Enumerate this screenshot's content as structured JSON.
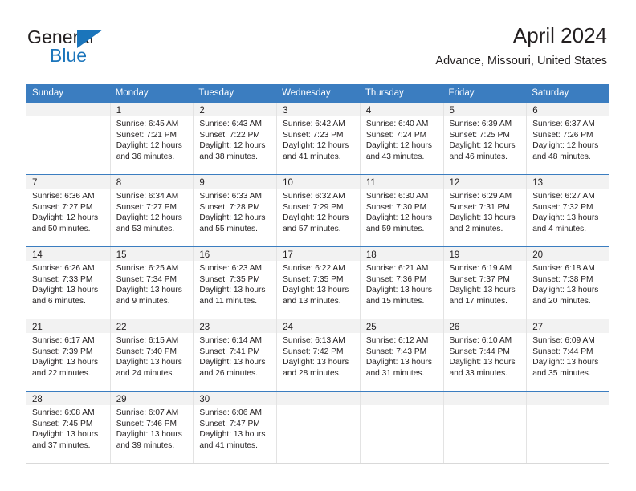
{
  "brand": {
    "name_part1": "General",
    "name_part2": "Blue",
    "triangle_color": "#1b75bb"
  },
  "header": {
    "title": "April 2024",
    "subtitle": "Advance, Missouri, United States"
  },
  "theme": {
    "header_blue": "#3b7dc0",
    "daynum_band": "#f2f2f2",
    "text": "#231f20"
  },
  "calendar": {
    "weekday_headers": [
      "Sunday",
      "Monday",
      "Tuesday",
      "Wednesday",
      "Thursday",
      "Friday",
      "Saturday"
    ],
    "weeks": [
      [
        {
          "day": "",
          "sunrise": "",
          "sunset": "",
          "daylight": "",
          "daylight2": ""
        },
        {
          "day": "1",
          "sunrise": "Sunrise: 6:45 AM",
          "sunset": "Sunset: 7:21 PM",
          "daylight": "Daylight: 12 hours",
          "daylight2": "and 36 minutes."
        },
        {
          "day": "2",
          "sunrise": "Sunrise: 6:43 AM",
          "sunset": "Sunset: 7:22 PM",
          "daylight": "Daylight: 12 hours",
          "daylight2": "and 38 minutes."
        },
        {
          "day": "3",
          "sunrise": "Sunrise: 6:42 AM",
          "sunset": "Sunset: 7:23 PM",
          "daylight": "Daylight: 12 hours",
          "daylight2": "and 41 minutes."
        },
        {
          "day": "4",
          "sunrise": "Sunrise: 6:40 AM",
          "sunset": "Sunset: 7:24 PM",
          "daylight": "Daylight: 12 hours",
          "daylight2": "and 43 minutes."
        },
        {
          "day": "5",
          "sunrise": "Sunrise: 6:39 AM",
          "sunset": "Sunset: 7:25 PM",
          "daylight": "Daylight: 12 hours",
          "daylight2": "and 46 minutes."
        },
        {
          "day": "6",
          "sunrise": "Sunrise: 6:37 AM",
          "sunset": "Sunset: 7:26 PM",
          "daylight": "Daylight: 12 hours",
          "daylight2": "and 48 minutes."
        }
      ],
      [
        {
          "day": "7",
          "sunrise": "Sunrise: 6:36 AM",
          "sunset": "Sunset: 7:27 PM",
          "daylight": "Daylight: 12 hours",
          "daylight2": "and 50 minutes."
        },
        {
          "day": "8",
          "sunrise": "Sunrise: 6:34 AM",
          "sunset": "Sunset: 7:27 PM",
          "daylight": "Daylight: 12 hours",
          "daylight2": "and 53 minutes."
        },
        {
          "day": "9",
          "sunrise": "Sunrise: 6:33 AM",
          "sunset": "Sunset: 7:28 PM",
          "daylight": "Daylight: 12 hours",
          "daylight2": "and 55 minutes."
        },
        {
          "day": "10",
          "sunrise": "Sunrise: 6:32 AM",
          "sunset": "Sunset: 7:29 PM",
          "daylight": "Daylight: 12 hours",
          "daylight2": "and 57 minutes."
        },
        {
          "day": "11",
          "sunrise": "Sunrise: 6:30 AM",
          "sunset": "Sunset: 7:30 PM",
          "daylight": "Daylight: 12 hours",
          "daylight2": "and 59 minutes."
        },
        {
          "day": "12",
          "sunrise": "Sunrise: 6:29 AM",
          "sunset": "Sunset: 7:31 PM",
          "daylight": "Daylight: 13 hours",
          "daylight2": "and 2 minutes."
        },
        {
          "day": "13",
          "sunrise": "Sunrise: 6:27 AM",
          "sunset": "Sunset: 7:32 PM",
          "daylight": "Daylight: 13 hours",
          "daylight2": "and 4 minutes."
        }
      ],
      [
        {
          "day": "14",
          "sunrise": "Sunrise: 6:26 AM",
          "sunset": "Sunset: 7:33 PM",
          "daylight": "Daylight: 13 hours",
          "daylight2": "and 6 minutes."
        },
        {
          "day": "15",
          "sunrise": "Sunrise: 6:25 AM",
          "sunset": "Sunset: 7:34 PM",
          "daylight": "Daylight: 13 hours",
          "daylight2": "and 9 minutes."
        },
        {
          "day": "16",
          "sunrise": "Sunrise: 6:23 AM",
          "sunset": "Sunset: 7:35 PM",
          "daylight": "Daylight: 13 hours",
          "daylight2": "and 11 minutes."
        },
        {
          "day": "17",
          "sunrise": "Sunrise: 6:22 AM",
          "sunset": "Sunset: 7:35 PM",
          "daylight": "Daylight: 13 hours",
          "daylight2": "and 13 minutes."
        },
        {
          "day": "18",
          "sunrise": "Sunrise: 6:21 AM",
          "sunset": "Sunset: 7:36 PM",
          "daylight": "Daylight: 13 hours",
          "daylight2": "and 15 minutes."
        },
        {
          "day": "19",
          "sunrise": "Sunrise: 6:19 AM",
          "sunset": "Sunset: 7:37 PM",
          "daylight": "Daylight: 13 hours",
          "daylight2": "and 17 minutes."
        },
        {
          "day": "20",
          "sunrise": "Sunrise: 6:18 AM",
          "sunset": "Sunset: 7:38 PM",
          "daylight": "Daylight: 13 hours",
          "daylight2": "and 20 minutes."
        }
      ],
      [
        {
          "day": "21",
          "sunrise": "Sunrise: 6:17 AM",
          "sunset": "Sunset: 7:39 PM",
          "daylight": "Daylight: 13 hours",
          "daylight2": "and 22 minutes."
        },
        {
          "day": "22",
          "sunrise": "Sunrise: 6:15 AM",
          "sunset": "Sunset: 7:40 PM",
          "daylight": "Daylight: 13 hours",
          "daylight2": "and 24 minutes."
        },
        {
          "day": "23",
          "sunrise": "Sunrise: 6:14 AM",
          "sunset": "Sunset: 7:41 PM",
          "daylight": "Daylight: 13 hours",
          "daylight2": "and 26 minutes."
        },
        {
          "day": "24",
          "sunrise": "Sunrise: 6:13 AM",
          "sunset": "Sunset: 7:42 PM",
          "daylight": "Daylight: 13 hours",
          "daylight2": "and 28 minutes."
        },
        {
          "day": "25",
          "sunrise": "Sunrise: 6:12 AM",
          "sunset": "Sunset: 7:43 PM",
          "daylight": "Daylight: 13 hours",
          "daylight2": "and 31 minutes."
        },
        {
          "day": "26",
          "sunrise": "Sunrise: 6:10 AM",
          "sunset": "Sunset: 7:44 PM",
          "daylight": "Daylight: 13 hours",
          "daylight2": "and 33 minutes."
        },
        {
          "day": "27",
          "sunrise": "Sunrise: 6:09 AM",
          "sunset": "Sunset: 7:44 PM",
          "daylight": "Daylight: 13 hours",
          "daylight2": "and 35 minutes."
        }
      ],
      [
        {
          "day": "28",
          "sunrise": "Sunrise: 6:08 AM",
          "sunset": "Sunset: 7:45 PM",
          "daylight": "Daylight: 13 hours",
          "daylight2": "and 37 minutes."
        },
        {
          "day": "29",
          "sunrise": "Sunrise: 6:07 AM",
          "sunset": "Sunset: 7:46 PM",
          "daylight": "Daylight: 13 hours",
          "daylight2": "and 39 minutes."
        },
        {
          "day": "30",
          "sunrise": "Sunrise: 6:06 AM",
          "sunset": "Sunset: 7:47 PM",
          "daylight": "Daylight: 13 hours",
          "daylight2": "and 41 minutes."
        },
        {
          "day": "",
          "sunrise": "",
          "sunset": "",
          "daylight": "",
          "daylight2": ""
        },
        {
          "day": "",
          "sunrise": "",
          "sunset": "",
          "daylight": "",
          "daylight2": ""
        },
        {
          "day": "",
          "sunrise": "",
          "sunset": "",
          "daylight": "",
          "daylight2": ""
        },
        {
          "day": "",
          "sunrise": "",
          "sunset": "",
          "daylight": "",
          "daylight2": ""
        }
      ]
    ]
  }
}
